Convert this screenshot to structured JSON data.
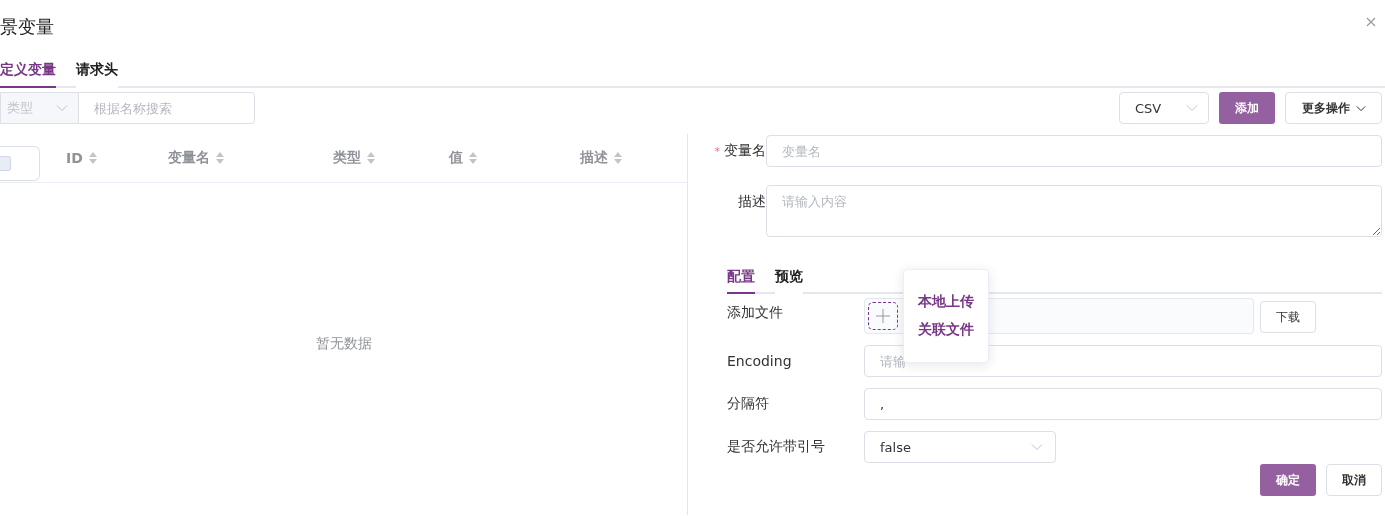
{
  "dialog": {
    "title": "景变量"
  },
  "tabs": [
    {
      "label": "定义变量",
      "selected": true
    },
    {
      "label": "请求头",
      "selected": false
    }
  ],
  "filter": {
    "type_placeholder": "类型",
    "search_placeholder": "根据名称搜索"
  },
  "actions": {
    "type_value": "CSV",
    "add": "添加",
    "more": "更多操作"
  },
  "table": {
    "select_all_checked": false,
    "columns": [
      "ID",
      "变量名",
      "类型",
      "值",
      "描述"
    ],
    "empty_text": "暂无数据"
  },
  "form": {
    "name": {
      "label": "变量名",
      "required_mark": "*",
      "placeholder": "变量名"
    },
    "description": {
      "label": "描述",
      "placeholder": "请输入内容"
    }
  },
  "config_tabs": [
    {
      "label": "配置",
      "selected": true
    },
    {
      "label": "预览",
      "selected": false
    }
  ],
  "config": {
    "file_label": "添加文件",
    "download": "下载",
    "encoding": {
      "label": "Encoding",
      "placeholder": "请输"
    },
    "delimiter": {
      "label": "分隔符",
      "value": ","
    },
    "quote": {
      "label": "是否允许带引号",
      "value": "false"
    }
  },
  "upload_menu": [
    "本地上传",
    "关联文件"
  ],
  "buttons": {
    "confirm": "确定",
    "cancel": "取消"
  }
}
